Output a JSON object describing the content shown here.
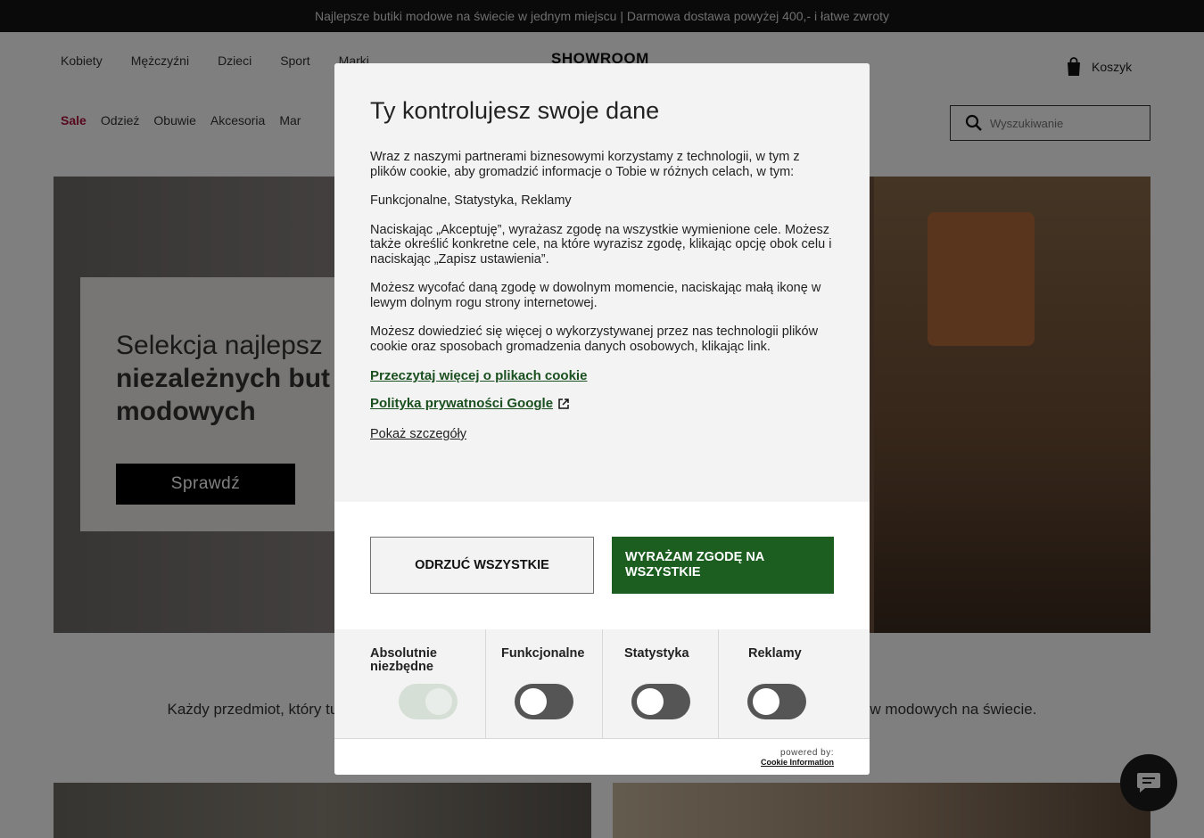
{
  "topbar": {
    "text": "Najlepsze butiki modowe na świecie w jednym miejscu | Darmowa dostawa powyżej 400,- i łatwe zwroty"
  },
  "header": {
    "nav_main": [
      "Kobiety",
      "Mężczyźni",
      "Dzieci",
      "Sport",
      "Marki"
    ],
    "logo": "SHOWROOM",
    "cart_label": "Koszyk",
    "nav_sub": [
      "Sale",
      "Odzież",
      "Obuwie",
      "Akcesoria",
      "Mar"
    ],
    "search_placeholder": "Wyszukiwanie"
  },
  "hero": {
    "title_line1": "Selekcja najlepsz",
    "title_line2": "niezależnych but",
    "title_line3": "modowych",
    "cta": "Sprawdź"
  },
  "tagline": "Każdy przedmiot, który tu znajdziesz, je                                                                               lepszych butików modowych na świecie.",
  "cookie": {
    "title": "Ty kontrolujesz swoje dane",
    "p1": "Wraz z naszymi partnerami biznesowymi korzystamy z technologii, w tym z plików cookie, aby gromadzić informacje o Tobie w różnych celach, w tym:",
    "p2": "Funkcjonalne, Statystyka, Reklamy",
    "p3": "Naciskając „Akceptuję”, wyrażasz zgodę na wszystkie wymienione cele. Możesz także określić konkretne cele, na które wyrazisz zgodę, klikając opcję obok celu i naciskając „Zapisz ustawienia”.",
    "p4": "Możesz wycofać daną zgodę w dowolnym momencie, naciskając małą ikonę w lewym dolnym rogu strony internetowej.",
    "p5": "Możesz dowiedzieć się więcej o wykorzystywanej przez nas technologii plików cookie oraz sposobach gromadzenia danych osobowych, klikając link.",
    "link_cookies": "Przeczytaj więcej o plikach cookie",
    "link_google": "Polityka prywatności Google",
    "show_details": "Pokaż szczegóły",
    "btn_reject": "ODRZUĆ WSZYSTKIE",
    "btn_accept": "WYRAŻAM ZGODĘ NA WSZYSTKIE",
    "categories": [
      {
        "label": "Absolutnie niezbędne",
        "enabled": true
      },
      {
        "label": "Funkcjonalne",
        "enabled": false
      },
      {
        "label": "Statystyka",
        "enabled": false
      },
      {
        "label": "Reklamy",
        "enabled": false
      }
    ],
    "powered_by": "powered by:",
    "provider": "Cookie Information"
  },
  "colors": {
    "accept_green": "#1b5e20",
    "link_green": "#1a4f1f",
    "sale_red": "#b0103a",
    "topbar_bg": "#141414"
  }
}
